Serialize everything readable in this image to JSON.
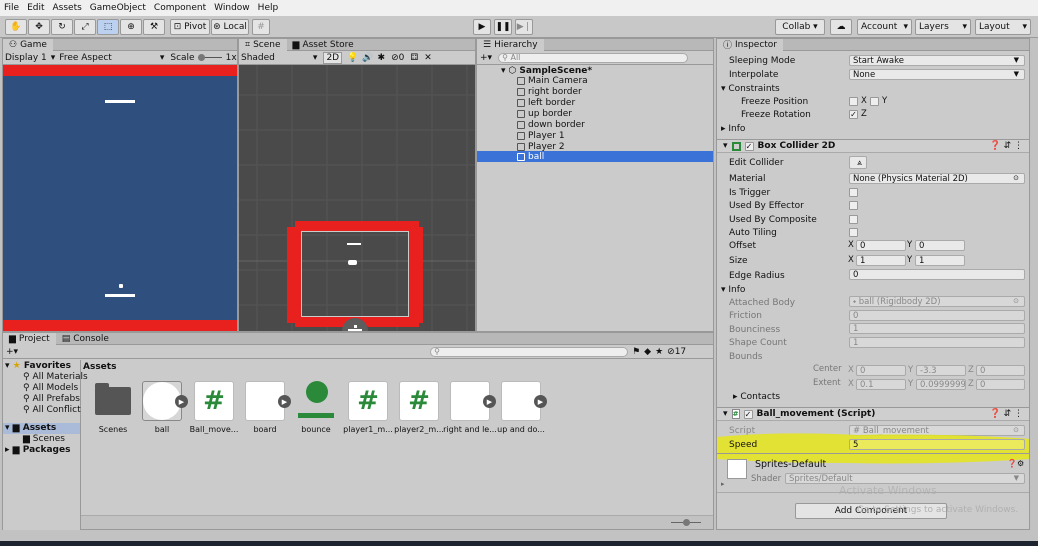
{
  "menu": [
    "File",
    "Edit",
    "Assets",
    "GameObject",
    "Component",
    "Window",
    "Help"
  ],
  "toolbar": {
    "pivot": "Pivot",
    "local": "Local",
    "collab": "Collab",
    "account": "Account",
    "layers": "Layers",
    "layout": "Layout"
  },
  "game": {
    "tab": "Game",
    "display": "Display 1",
    "aspect": "Free Aspect",
    "scale_label": "Scale",
    "scale_value": "1x"
  },
  "scene": {
    "tab": "Scene",
    "asset_store_tab": "Asset Store",
    "shading": "Shaded",
    "mode_2d": "2D",
    "gizmo_count": "0"
  },
  "hierarchy": {
    "tab": "Hierarchy",
    "search_placeholder": "All",
    "scene_name": "SampleScene*",
    "items": [
      "Main Camera",
      "right border",
      "left border",
      "up border",
      "down border",
      "Player 1",
      "Player 2",
      "ball"
    ],
    "selected": "ball"
  },
  "project": {
    "tab": "Project",
    "console_tab": "Console",
    "favorites_label": "Favorites",
    "favorites": [
      "All Materials",
      "All Models",
      "All Prefabs",
      "All Conflicte"
    ],
    "assets_label": "Assets",
    "assets_children": [
      "Scenes"
    ],
    "packages_label": "Packages",
    "breadcrumb": "Assets",
    "hidden_count": "17",
    "assets": [
      {
        "label": "Scenes",
        "kind": "folder"
      },
      {
        "label": "ball",
        "kind": "circle"
      },
      {
        "label": "Ball_move...",
        "kind": "script"
      },
      {
        "label": "board",
        "kind": "sprite"
      },
      {
        "label": "bounce",
        "kind": "material"
      },
      {
        "label": "player1_m...",
        "kind": "script"
      },
      {
        "label": "player2_m...",
        "kind": "script"
      },
      {
        "label": "right and le...",
        "kind": "sprite"
      },
      {
        "label": "up and do...",
        "kind": "sprite"
      }
    ]
  },
  "inspector": {
    "tab": "Inspector",
    "rigidbody": {
      "sleeping_mode_label": "Sleeping Mode",
      "sleeping_mode_value": "Start Awake",
      "interpolate_label": "Interpolate",
      "interpolate_value": "None",
      "constraints_label": "Constraints",
      "freeze_position_label": "Freeze Position",
      "freeze_rotation_label": "Freeze Rotation",
      "x": "X",
      "y": "Y",
      "z": "Z",
      "info_label": "Info"
    },
    "box_collider": {
      "title": "Box Collider 2D",
      "edit_collider": "Edit Collider",
      "material_label": "Material",
      "material_value": "None (Physics Material 2D)",
      "is_trigger": "Is Trigger",
      "used_by_effector": "Used By Effector",
      "used_by_composite": "Used By Composite",
      "auto_tiling": "Auto Tiling",
      "offset_label": "Offset",
      "offset_x": "0",
      "offset_y": "0",
      "size_label": "Size",
      "size_x": "1",
      "size_y": "1",
      "edge_radius_label": "Edge Radius",
      "edge_radius_value": "0",
      "info_label": "Info",
      "attached_body_label": "Attached Body",
      "attached_body_value": "ball (Rigidbody 2D)",
      "friction_label": "Friction",
      "friction_value": "0",
      "bounciness_label": "Bounciness",
      "bounciness_value": "1",
      "shape_count_label": "Shape Count",
      "shape_count_value": "1",
      "bounds_label": "Bounds",
      "center_label": "Center",
      "center_x": "0",
      "center_y": "-3.3",
      "center_z": "0",
      "extent_label": "Extent",
      "extent_x": "0.1",
      "extent_y": "0.0999999",
      "extent_z": "0",
      "contacts_label": "Contacts"
    },
    "script_comp": {
      "title": "Ball_movement (Script)",
      "script_label": "Script",
      "script_value": "Ball_movement",
      "speed_label": "Speed",
      "speed_value": "5"
    },
    "material": {
      "name": "Sprites-Default",
      "shader_label": "Shader",
      "shader_value": "Sprites/Default"
    },
    "add_component": "Add Component",
    "watermark_1": "Activate Windows",
    "watermark_2": "Go to Settings to activate Windows."
  },
  "colors": {
    "game_bg": "#2f4f7f",
    "border_red": "#e8201e",
    "selection": "#3a72d8",
    "highlight": "#e8e81a",
    "scene_bg": "#4a4a4a"
  }
}
